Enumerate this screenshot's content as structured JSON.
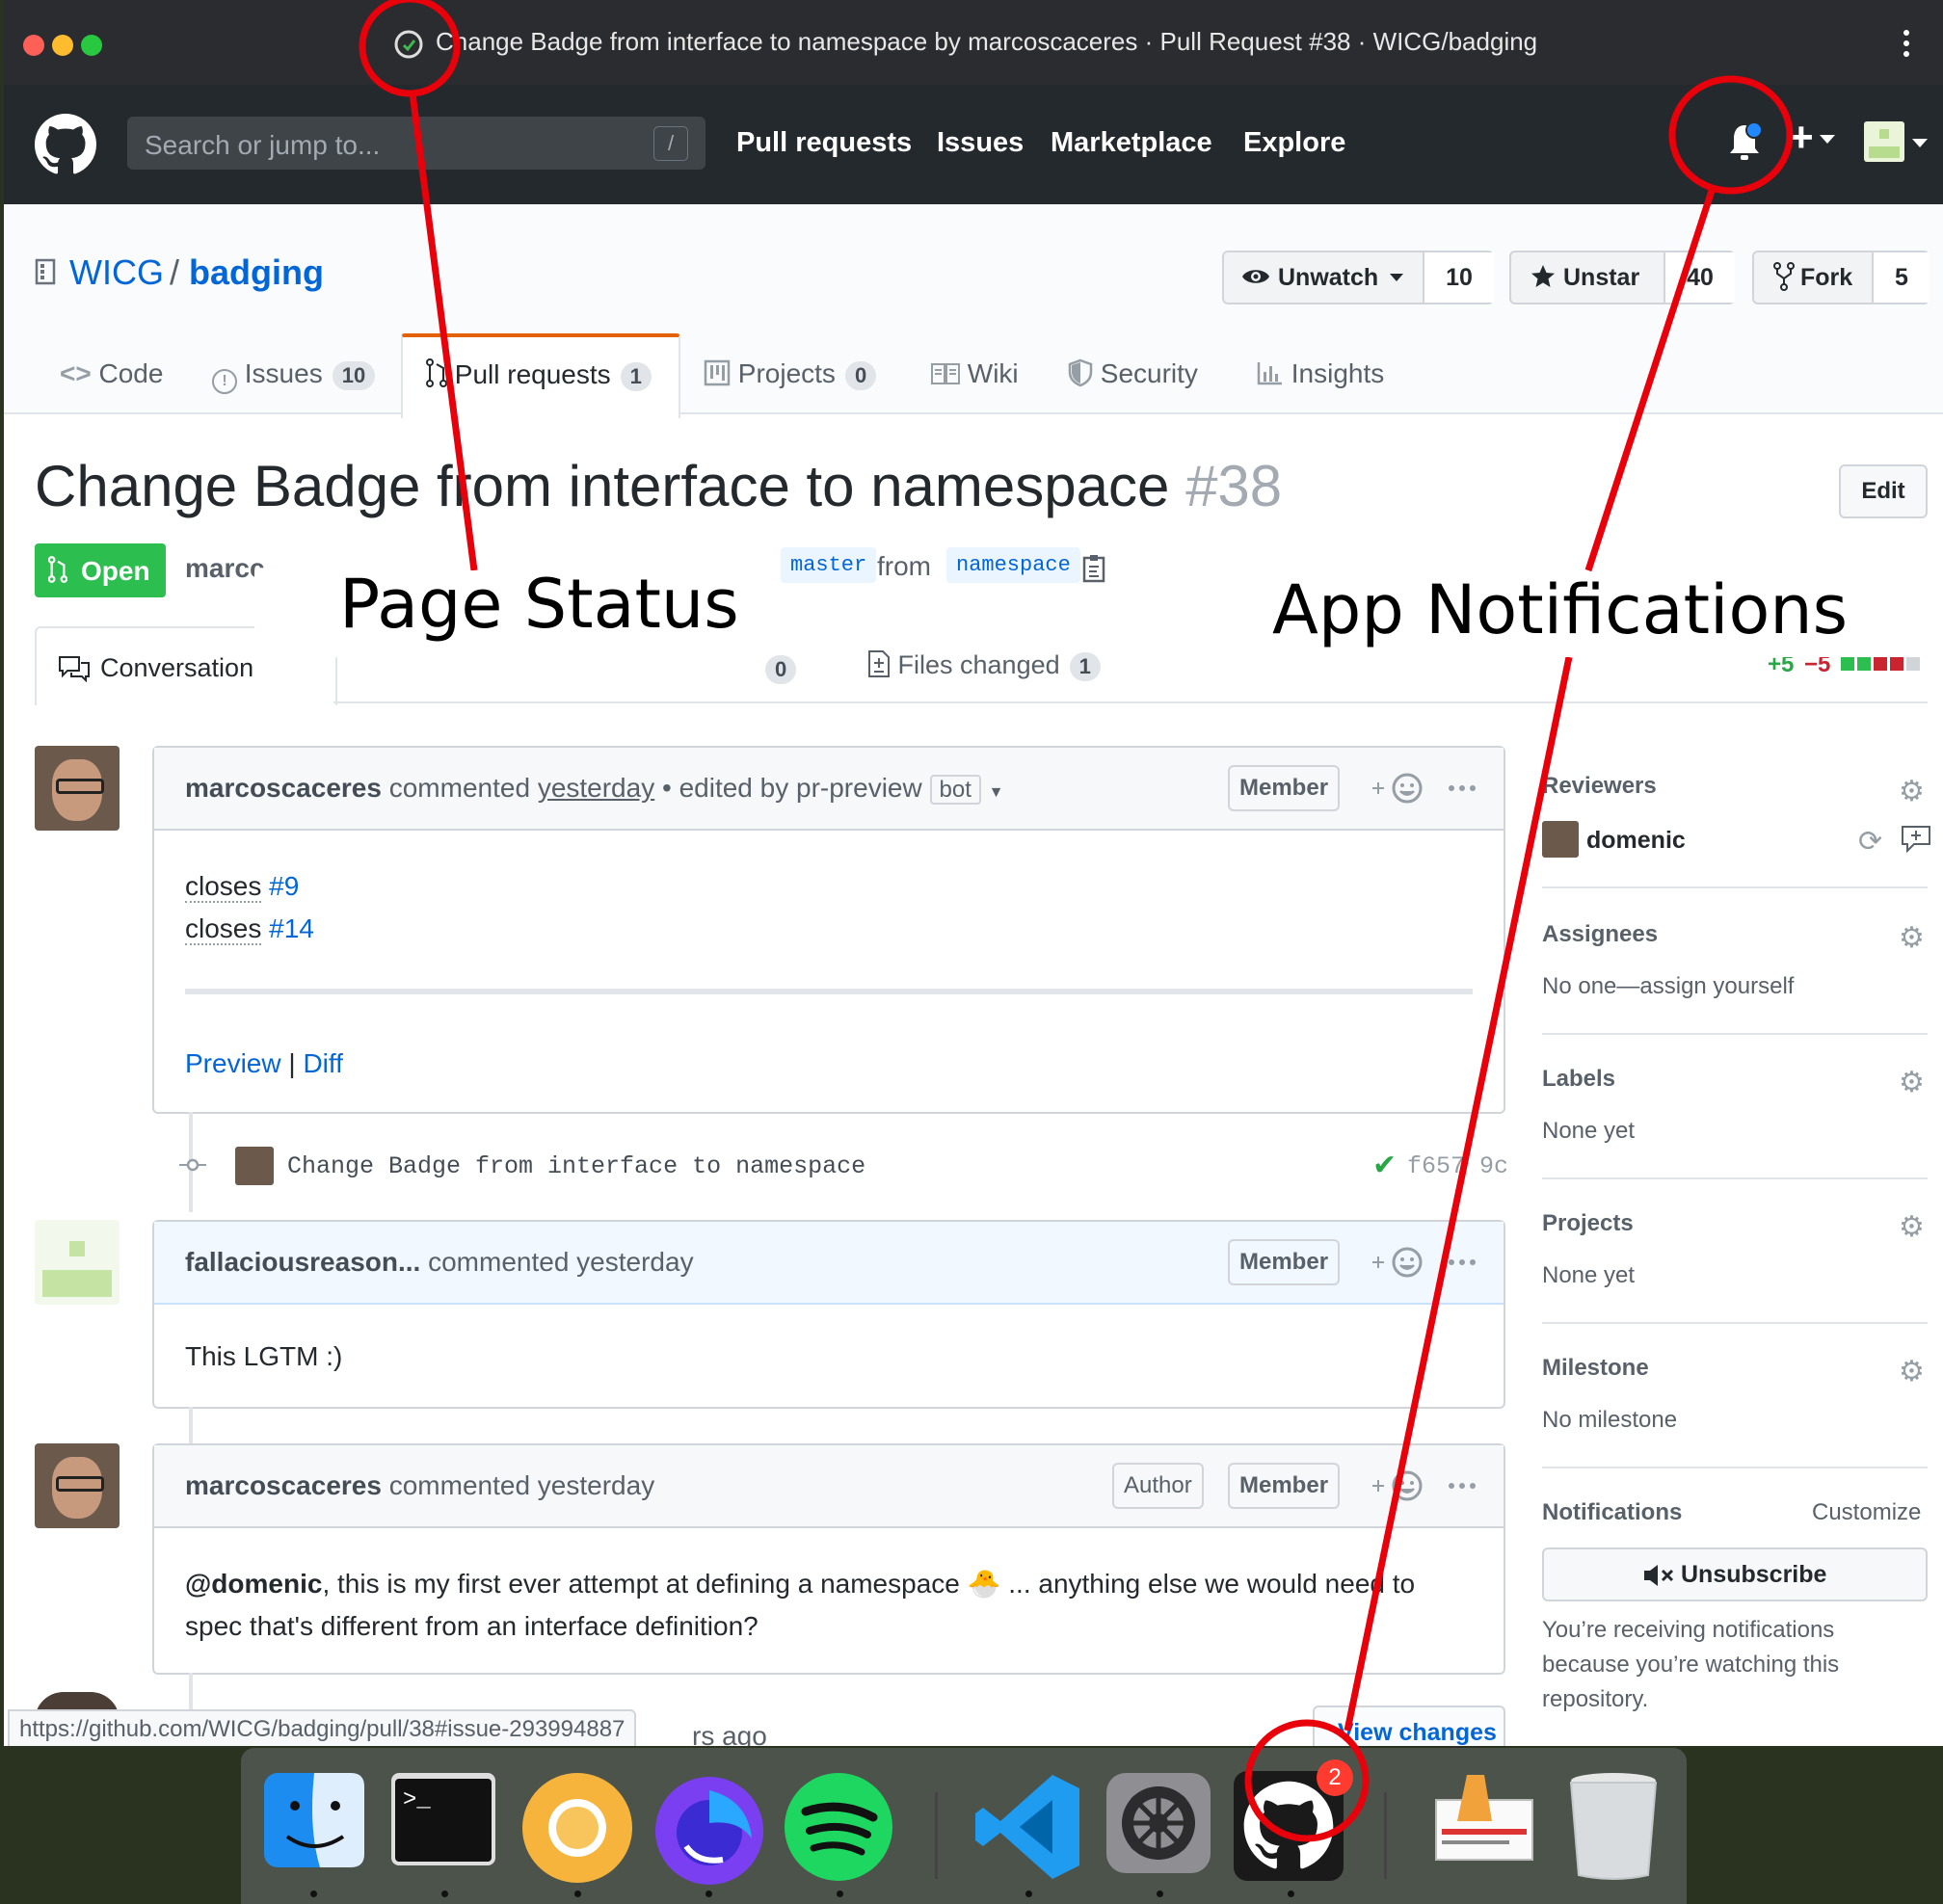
{
  "window": {
    "title": "Change Badge from interface to namespace by marcoscaceres · Pull Request #38 · WICG/badging"
  },
  "header": {
    "search_placeholder": "Search or jump to...",
    "search_shortcut": "/",
    "nav": [
      "Pull requests",
      "Issues",
      "Marketplace",
      "Explore"
    ],
    "plus": "+"
  },
  "repo": {
    "owner": "WICG",
    "separator": "/",
    "name": "badging",
    "unwatch_label": "Unwatch",
    "watch_count": "10",
    "unstar_label": "Unstar",
    "star_count": "40",
    "fork_label": "Fork",
    "fork_count": "5",
    "tabs": [
      {
        "label": "Code",
        "count": ""
      },
      {
        "label": "Issues",
        "count": "10"
      },
      {
        "label": "Pull requests",
        "count": "1"
      },
      {
        "label": "Projects",
        "count": "0"
      },
      {
        "label": "Wiki",
        "count": ""
      },
      {
        "label": "Security",
        "count": ""
      },
      {
        "label": "Insights",
        "count": ""
      }
    ]
  },
  "pr": {
    "title": "Change Badge from interface to namespace",
    "number": "#38",
    "edit_label": "Edit",
    "state": "Open",
    "author_partial": "marcc",
    "base_branch": "master",
    "from_word": "from",
    "head_branch": "namespace",
    "tabs": {
      "conversation": "Conversation",
      "checks_count": "0",
      "files_changed": "Files changed",
      "files_count": "1"
    },
    "diffstat_add": "+5",
    "diffstat_del": "−5"
  },
  "timeline": {
    "comment1": {
      "author": "marcoscaceres",
      "action": "commented",
      "time": "yesterday",
      "edited": "• edited by pr-preview",
      "bot": "bot",
      "badge": "Member",
      "line1_word": "closes",
      "line1_ref": "#9",
      "line2_word": "closes",
      "line2_ref": "#14",
      "preview": "Preview",
      "sep": "|",
      "diff": "Diff"
    },
    "commit": {
      "message": "Change Badge from interface to namespace",
      "sha": "f657 9c"
    },
    "comment2": {
      "author": "fallaciousreason...",
      "action": "commented yesterday",
      "badge": "Member",
      "body": "This LGTM :)"
    },
    "comment3": {
      "author": "marcoscaceres",
      "action": "commented yesterday",
      "badge_author": "Author",
      "badge_member": "Member",
      "mention": "@domenic",
      "body_a": ", this is my first ever attempt at defining a namespace 🐣 ... anything else we would need to",
      "body_b": "spec that's different from an interface definition?"
    },
    "partial_time": "rs ago",
    "view_changes": "View changes"
  },
  "sidebar": {
    "reviewers_label": "Reviewers",
    "reviewer": "domenic",
    "assignees_label": "Assignees",
    "assignees_value": "No one—assign yourself",
    "labels_label": "Labels",
    "labels_value": "None yet",
    "projects_label": "Projects",
    "projects_value": "None yet",
    "milestone_label": "Milestone",
    "milestone_value": "No milestone",
    "notifications_label": "Notifications",
    "customize": "Customize",
    "unsubscribe": "Unsubscribe",
    "notif_line1": "You’re receiving notifications",
    "notif_line2": "because you’re watching this",
    "notif_line3": "repository."
  },
  "status_url": "https://github.com/WICG/badging/pull/38#issue-293994887",
  "dock": {
    "apps": [
      "finder-icon",
      "terminal-icon",
      "chrome-canary-icon",
      "firefox-icon",
      "spotify-icon",
      "vscode-icon",
      "system-preferences-icon",
      "github-app-icon",
      "preview-icon",
      "trash-icon"
    ],
    "github_badge": "2"
  },
  "annotations": {
    "page_status": "Page Status",
    "app_notifications": "App Notifications"
  },
  "colors": {
    "header": "#24292e",
    "link": "#0366d6",
    "open_green": "#2cbe4e",
    "annotation_red": "#e8000b"
  }
}
